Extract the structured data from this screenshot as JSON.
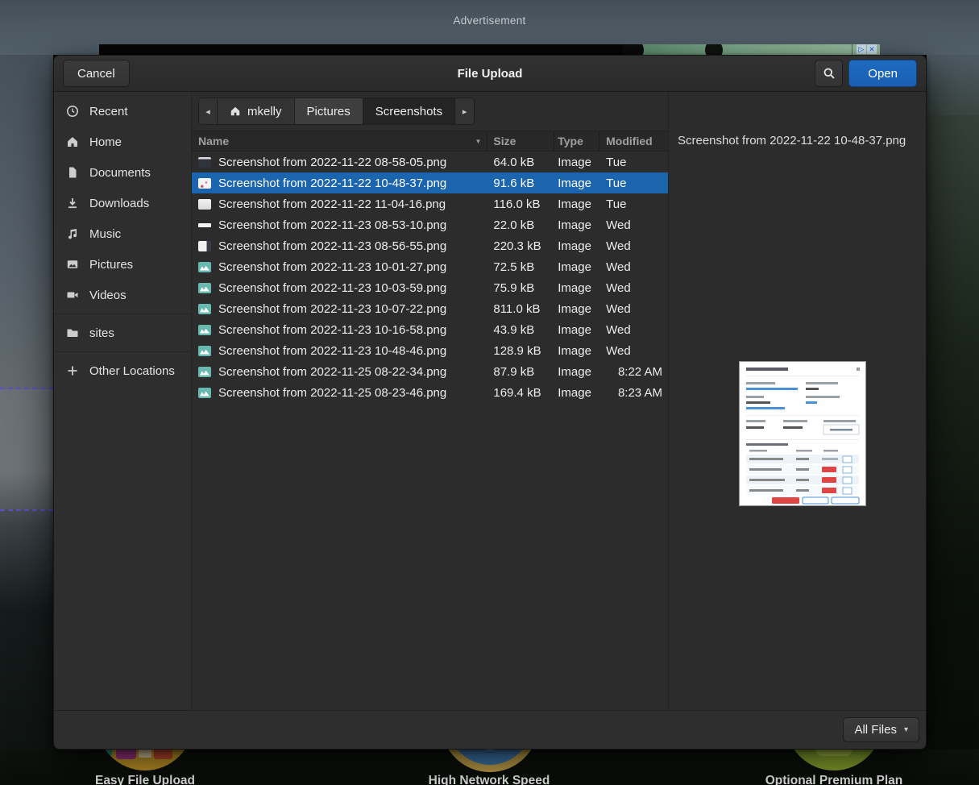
{
  "desktop": {
    "advertisement_label": "Advertisement",
    "features": [
      "Easy File Upload",
      "High Network Speed",
      "Optional Premium Plan"
    ]
  },
  "icons": {
    "back": "◂",
    "forward": "▸",
    "sort_desc": "▼",
    "dropdown": "▾",
    "adchoices_arrow": "▷",
    "adchoices_close": "✕"
  },
  "dialog": {
    "title": "File Upload",
    "buttons": {
      "cancel": "Cancel",
      "open": "Open"
    },
    "filter": {
      "label": "All Files"
    },
    "sidebar": {
      "items": [
        {
          "label": "Recent"
        },
        {
          "label": "Home"
        },
        {
          "label": "Documents"
        },
        {
          "label": "Downloads"
        },
        {
          "label": "Music"
        },
        {
          "label": "Pictures"
        },
        {
          "label": "Videos"
        },
        {
          "label": "sites"
        },
        {
          "label": "Other Locations"
        }
      ]
    },
    "pathbar": {
      "home": "mkelly",
      "pictures": "Pictures",
      "screenshots": "Screenshots"
    },
    "list": {
      "columns": {
        "name": "Name",
        "size": "Size",
        "type": "Type",
        "modified": "Modified"
      },
      "rows": [
        {
          "name": "Screenshot from 2022-11-22 08-58-05.png",
          "size": "64.0 kB",
          "type": "Image",
          "modified": "Tue"
        },
        {
          "name": "Screenshot from 2022-11-22 10-48-37.png",
          "size": "91.6 kB",
          "type": "Image",
          "modified": "Tue",
          "selected": true
        },
        {
          "name": "Screenshot from 2022-11-22 11-04-16.png",
          "size": "116.0 kB",
          "type": "Image",
          "modified": "Tue"
        },
        {
          "name": "Screenshot from 2022-11-23 08-53-10.png",
          "size": "22.0 kB",
          "type": "Image",
          "modified": "Wed"
        },
        {
          "name": "Screenshot from 2022-11-23 08-56-55.png",
          "size": "220.3 kB",
          "type": "Image",
          "modified": "Wed"
        },
        {
          "name": "Screenshot from 2022-11-23 10-01-27.png",
          "size": "72.5 kB",
          "type": "Image",
          "modified": "Wed"
        },
        {
          "name": "Screenshot from 2022-11-23 10-03-59.png",
          "size": "75.9 kB",
          "type": "Image",
          "modified": "Wed"
        },
        {
          "name": "Screenshot from 2022-11-23 10-07-22.png",
          "size": "811.0 kB",
          "type": "Image",
          "modified": "Wed"
        },
        {
          "name": "Screenshot from 2022-11-23 10-16-58.png",
          "size": "43.9 kB",
          "type": "Image",
          "modified": "Wed"
        },
        {
          "name": "Screenshot from 2022-11-23 10-48-46.png",
          "size": "128.9 kB",
          "type": "Image",
          "modified": "Wed"
        },
        {
          "name": "Screenshot from 2022-11-25 08-22-34.png",
          "size": "87.9 kB",
          "type": "Image",
          "modified": "8:22 AM"
        },
        {
          "name": "Screenshot from 2022-11-25 08-23-46.png",
          "size": "169.4 kB",
          "type": "Image",
          "modified": "8:23 AM"
        }
      ]
    },
    "preview": {
      "filename": "Screenshot from 2022-11-22 10-48-37.png"
    }
  },
  "colors": {
    "accent": "#1a5fb4",
    "selection": "#1b64ae",
    "thumbnail_teal": "#67b9b0",
    "ad_green": "#7da98a",
    "circle_gold": "#c19220",
    "circle_blue": "#3f7db3",
    "circle_green": "#86a52c"
  }
}
